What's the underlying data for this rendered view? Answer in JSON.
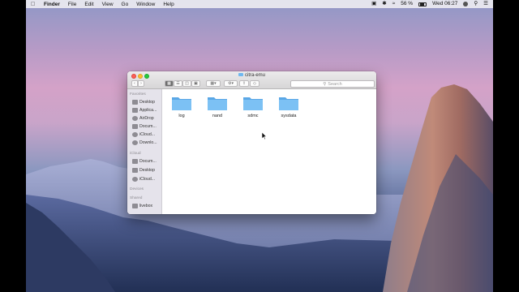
{
  "menubar": {
    "app": "Finder",
    "menus": [
      "File",
      "Edit",
      "View",
      "Go",
      "Window",
      "Help"
    ],
    "battery": "56 %",
    "clock": "Wed 06:27"
  },
  "window": {
    "title": "citra-emu",
    "search_placeholder": "Search"
  },
  "sidebar": {
    "favorites_header": "Favorites",
    "favorites": [
      {
        "label": "Desktop",
        "icon": "desktop-icon"
      },
      {
        "label": "Applica...",
        "icon": "applications-icon"
      },
      {
        "label": "AirDrop",
        "icon": "airdrop-icon"
      },
      {
        "label": "Docum...",
        "icon": "documents-icon"
      },
      {
        "label": "iCloud...",
        "icon": "icloud-icon"
      },
      {
        "label": "Downlo...",
        "icon": "downloads-icon"
      }
    ],
    "icloud_header": "iCloud",
    "icloud": [
      {
        "label": "Docum...",
        "icon": "documents-icon"
      },
      {
        "label": "Desktop",
        "icon": "desktop-icon"
      },
      {
        "label": "iCloud...",
        "icon": "icloud-icon"
      }
    ],
    "devices_header": "Devices",
    "shared_header": "Shared",
    "shared": [
      {
        "label": "livebox",
        "icon": "server-icon"
      }
    ]
  },
  "folders": [
    "log",
    "nand",
    "sdmc",
    "sysdata"
  ],
  "colors": {
    "folder": "#6fb8f0",
    "accent": "#3478f6"
  }
}
